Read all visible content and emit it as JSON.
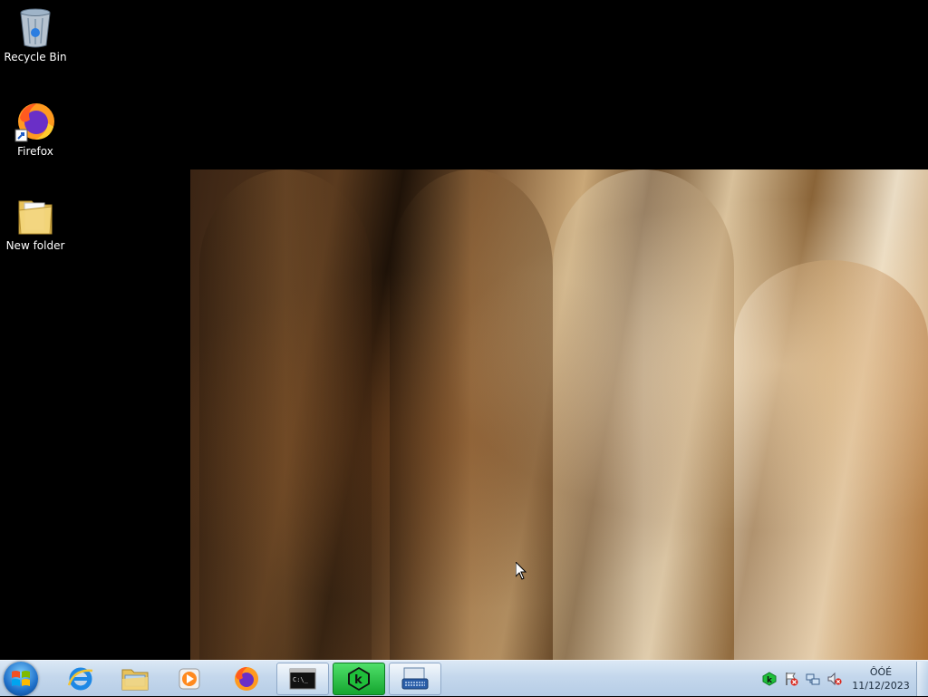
{
  "desktop": {
    "icons": [
      {
        "label": "Recycle Bin",
        "icon": "recycle-bin-icon"
      },
      {
        "label": "Firefox",
        "icon": "firefox-icon"
      },
      {
        "label": "New folder",
        "icon": "folder-icon"
      }
    ]
  },
  "taskbar": {
    "start": {
      "icon": "windows-start-icon"
    },
    "pinned": [
      {
        "name": "internet-explorer",
        "icon": "internet-explorer-icon",
        "active": false
      },
      {
        "name": "windows-explorer",
        "icon": "folder-explorer-icon",
        "active": false
      },
      {
        "name": "media-player",
        "icon": "media-player-icon",
        "active": false
      },
      {
        "name": "firefox",
        "icon": "firefox-icon",
        "active": false
      },
      {
        "name": "command-prompt",
        "icon": "cmd-icon",
        "active": true
      },
      {
        "name": "kaspersky",
        "icon": "kaspersky-icon",
        "active": true
      },
      {
        "name": "on-screen-keyboard",
        "icon": "keyboard-icon",
        "active": true
      }
    ],
    "tray": {
      "icons": [
        "kaspersky-tray-icon",
        "action-center-flag-icon",
        "network-icon",
        "volume-muted-icon"
      ],
      "clock_time": "ÔÓÉ",
      "clock_date": "11/12/2023"
    }
  },
  "colors": {
    "taskbar": "#c4d7ec",
    "kaspersky_green": "#1fbf3a",
    "start_orb": "#1e6fc9"
  }
}
